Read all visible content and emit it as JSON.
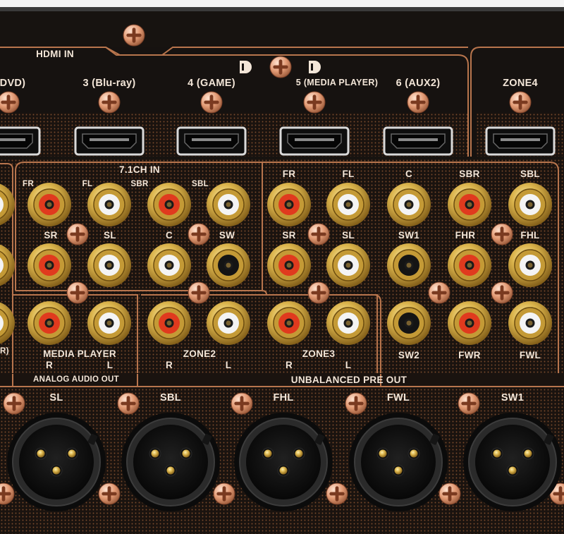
{
  "hdmi": {
    "title": "HDMI IN",
    "inputs": [
      "DVD)",
      "3 (Blu-ray)",
      "4 (GAME)",
      "5 (MEDIA PLAYER)",
      "6 (AUX2)"
    ],
    "zone4": "ZONE4"
  },
  "logo_text": "DD",
  "multich": {
    "title": "7.1CH IN",
    "row1": [
      "FR",
      "FL",
      "SBR",
      "SBL"
    ],
    "row2": [
      "SR",
      "SL",
      "C",
      "SW"
    ]
  },
  "preout": {
    "row1": [
      "FR",
      "FL",
      "C",
      "SBR",
      "SBL"
    ],
    "row2": [
      "SR",
      "SL",
      "SW1",
      "FHR",
      "FHL"
    ],
    "row3": [
      "SW2",
      "FWR",
      "FWL"
    ],
    "title": "UNBALANCED PRE OUT"
  },
  "analog_out": {
    "media_player": "MEDIA PLAYER",
    "zone2": "ZONE2",
    "zone3": "ZONE3",
    "r": "R",
    "l": "L",
    "title": "ANALOG AUDIO OUT",
    "left_edge": "R)"
  },
  "xlr": [
    "SL",
    "SBL",
    "FHL",
    "FWL",
    "SW1"
  ],
  "colors": {
    "panel": "#17120f",
    "dot": "#7a4a2c",
    "divider": "#b8754d",
    "text": "#f3e6d8",
    "gold": "#d9b24a",
    "red_insulator": "#e03a1e",
    "white_insulator": "#f4f4f4",
    "black_insulator": "#141414",
    "screw": "#e8a27e",
    "chassis_top": "#2a2a2a"
  }
}
